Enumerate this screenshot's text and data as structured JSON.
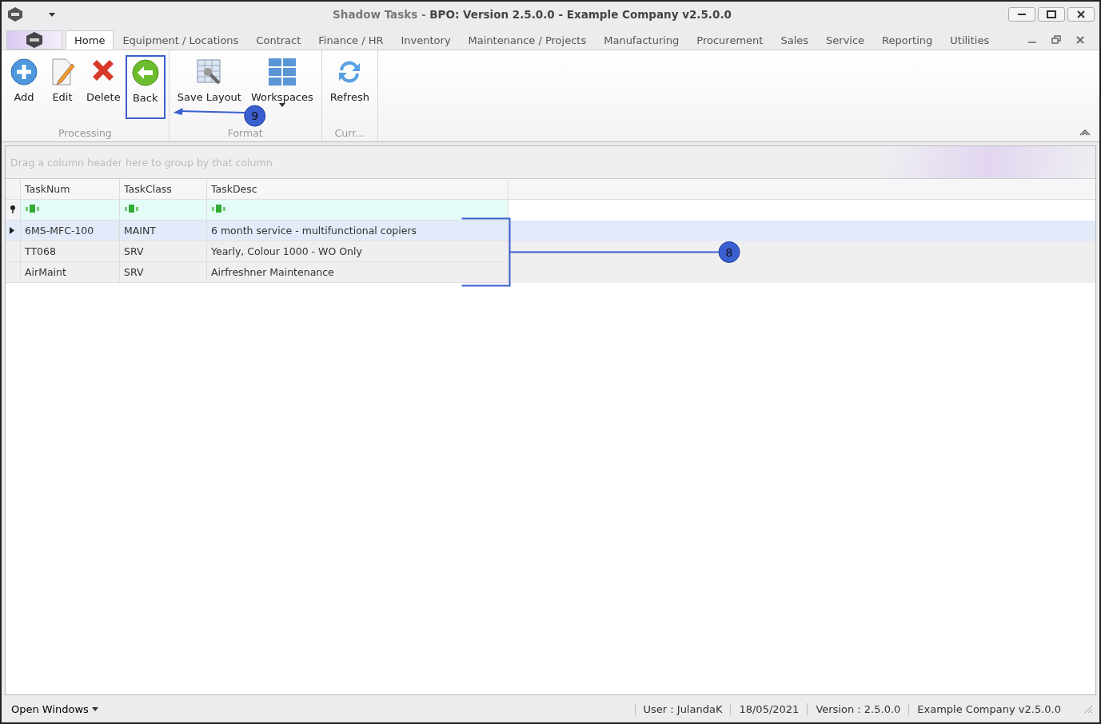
{
  "window": {
    "title_prefix": "Shadow Tasks - ",
    "title_main": "BPO: Version 2.5.0.0 - Example Company v2.5.0.0"
  },
  "tabs": [
    {
      "label": "Home",
      "selected": true
    },
    {
      "label": "Equipment / Locations",
      "selected": false
    },
    {
      "label": "Contract",
      "selected": false
    },
    {
      "label": "Finance / HR",
      "selected": false
    },
    {
      "label": "Inventory",
      "selected": false
    },
    {
      "label": "Maintenance / Projects",
      "selected": false
    },
    {
      "label": "Manufacturing",
      "selected": false
    },
    {
      "label": "Procurement",
      "selected": false
    },
    {
      "label": "Sales",
      "selected": false
    },
    {
      "label": "Service",
      "selected": false
    },
    {
      "label": "Reporting",
      "selected": false
    },
    {
      "label": "Utilities",
      "selected": false
    }
  ],
  "ribbon_groups": [
    {
      "label": "Processing",
      "buttons": [
        {
          "label": "Add",
          "kind": "add"
        },
        {
          "label": "Edit",
          "kind": "edit"
        },
        {
          "label": "Delete",
          "kind": "delete"
        },
        {
          "label": "Back",
          "kind": "back"
        }
      ]
    },
    {
      "label": "Format",
      "buttons": [
        {
          "label": "Save Layout",
          "kind": "layout"
        },
        {
          "label": "Workspaces",
          "kind": "workspaces"
        }
      ]
    },
    {
      "label": "Curr...",
      "buttons": [
        {
          "label": "Refresh",
          "kind": "refresh"
        }
      ]
    }
  ],
  "grid": {
    "group_panel_hint": "Drag a column header here to group by that column",
    "columns": [
      "TaskNum",
      "TaskClass",
      "TaskDesc"
    ],
    "rows": [
      {
        "cells": [
          "6MS-MFC-100",
          "MAINT",
          "6 month service - multifunctional copiers"
        ],
        "selected": true
      },
      {
        "cells": [
          "TT068",
          "SRV",
          "Yearly, Colour 1000 - WO Only"
        ],
        "selected": false
      },
      {
        "cells": [
          "AirMaint",
          "SRV",
          "Airfreshner Maintenance"
        ],
        "selected": false
      }
    ]
  },
  "annotations": [
    {
      "label": "9",
      "kind": "arrow"
    },
    {
      "label": "8",
      "kind": "bracket"
    }
  ],
  "status_bar": {
    "open_windows": "Open Windows",
    "items": [
      "User : JulandaK",
      "18/05/2021",
      "Version : 2.5.0.0",
      "Example Company v2.5.0.0"
    ]
  }
}
